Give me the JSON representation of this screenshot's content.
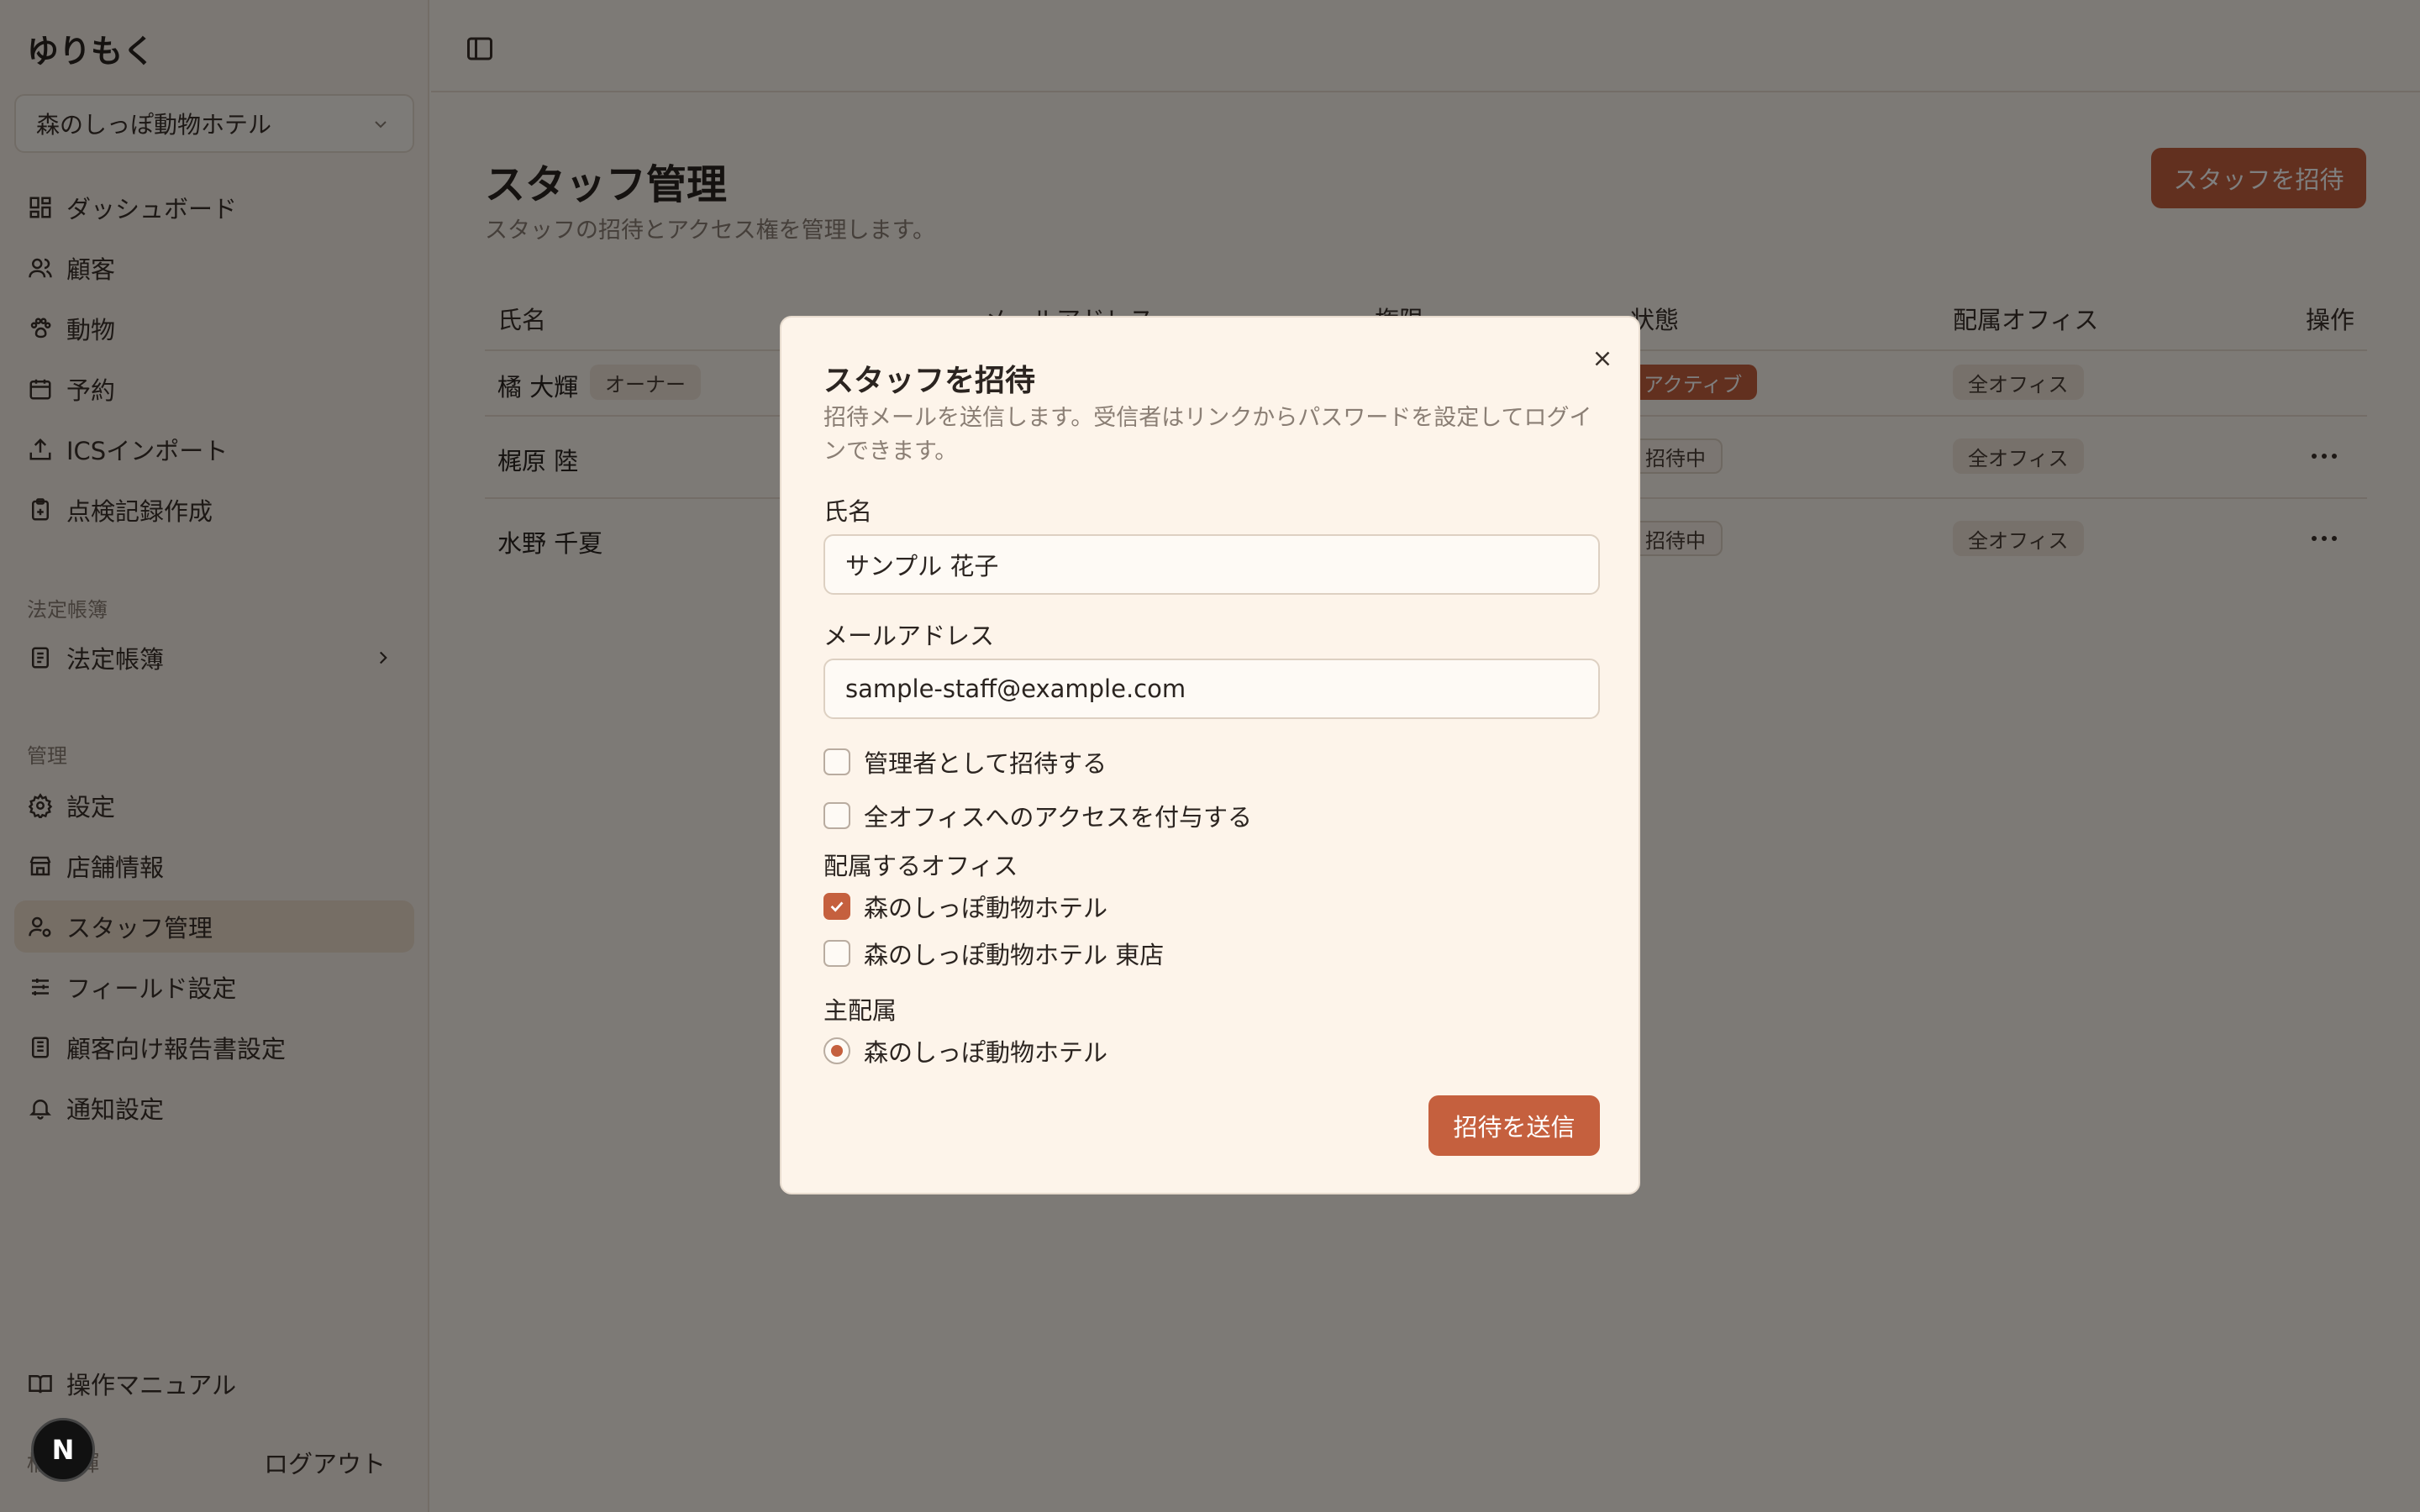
{
  "app": {
    "brand": "ゆりもく"
  },
  "sidebar": {
    "store_select": "森のしっぽ動物ホテル",
    "main_items": [
      {
        "label": "ダッシュボード",
        "icon": "dashboard-icon"
      },
      {
        "label": "顧客",
        "icon": "users-icon"
      },
      {
        "label": "動物",
        "icon": "paw-icon"
      },
      {
        "label": "予約",
        "icon": "calendar-icon"
      },
      {
        "label": "ICSインポート",
        "icon": "upload-icon"
      },
      {
        "label": "点検記録作成",
        "icon": "clipboard-icon"
      }
    ],
    "legal_section_label": "法定帳簿",
    "legal_item": {
      "label": "法定帳簿",
      "icon": "book-icon"
    },
    "admin_section_label": "管理",
    "admin_items": [
      {
        "label": "設定",
        "icon": "gear-icon"
      },
      {
        "label": "店舗情報",
        "icon": "store-icon"
      },
      {
        "label": "スタッフ管理",
        "icon": "user-cog-icon",
        "active": true
      },
      {
        "label": "フィールド設定",
        "icon": "sliders-icon"
      },
      {
        "label": "顧客向け報告書設定",
        "icon": "report-icon"
      },
      {
        "label": "通知設定",
        "icon": "bell-icon"
      }
    ],
    "manual": "操作マニュアル",
    "bottom_label": "橘 大輝",
    "logout": "ログアウト"
  },
  "page": {
    "title": "スタッフ管理",
    "subtitle": "スタッフの招待とアクセス権を管理します。",
    "invite_button": "スタッフを招待"
  },
  "table": {
    "headers": [
      "氏名",
      "メールアドレス",
      "権限",
      "状態",
      "配属オフィス",
      "操作"
    ],
    "rows": [
      {
        "name": "橘 大輝",
        "role_badge": "オーナー",
        "status": "アクティブ",
        "office": "全オフィス"
      },
      {
        "name": "梶原 陸",
        "status": "招待中",
        "office": "全オフィス"
      },
      {
        "name": "水野 千夏",
        "status": "招待中",
        "office": "全オフィス"
      }
    ]
  },
  "modal": {
    "title": "スタッフを招待",
    "description": "招待メールを送信します。受信者はリンクからパスワードを設定してログインできます。",
    "name_label": "氏名",
    "name_value": "サンプル 花子",
    "email_label": "メールアドレス",
    "email_value": "sample-staff@example.com",
    "admin_checkbox": "管理者として招待する",
    "all_offices_checkbox": "全オフィスへのアクセスを付与する",
    "offices_label": "配属するオフィス",
    "offices": [
      {
        "label": "森のしっぽ動物ホテル",
        "checked": true
      },
      {
        "label": "森のしっぽ動物ホテル 東店",
        "checked": false
      }
    ],
    "primary_label": "主配属",
    "primary_option": "森のしっぽ動物ホテル",
    "send_button": "招待を送信"
  },
  "colors": {
    "accent": "#c5603e",
    "background": "#fbf4ec",
    "sidebar": "#f7efe6"
  }
}
